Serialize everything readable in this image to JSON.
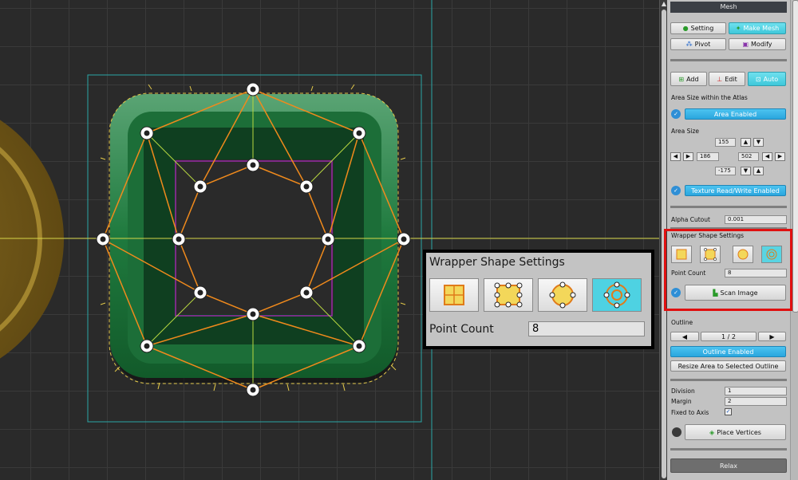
{
  "panel": {
    "title": "Mesh",
    "tabs": {
      "setting": "Setting",
      "make_mesh": "Make Mesh",
      "pivot": "Pivot",
      "modify": "Modify"
    },
    "modes": {
      "add": "Add",
      "edit": "Edit",
      "auto": "Auto"
    },
    "area_size_atlas_label": "Area Size within the Atlas",
    "area_enabled": "Area Enabled",
    "area_size_label": "Area Size",
    "area_values": {
      "top": "155",
      "left": "186",
      "right": "502",
      "bottom": "-175"
    },
    "texture_rw": "Texture Read/Write Enabled",
    "alpha_cutout_label": "Alpha Cutout",
    "alpha_cutout_value": "0.001",
    "wrapper_label": "Wrapper Shape Settings",
    "point_count_label": "Point Count",
    "point_count_value": "8",
    "scan_image": "Scan Image",
    "outline_label": "Outline",
    "outline_page": "1 / 2",
    "outline_enabled": "Outline Enabled",
    "resize_area": "Resize Area to Selected Outline",
    "division_label": "Division",
    "division_value": "1",
    "margin_label": "Margin",
    "margin_value": "2",
    "fixed_axis_label": "Fixed to Axis",
    "place_vertices": "Place Vertices",
    "relax": "Relax"
  },
  "zoom": {
    "title": "Wrapper Shape Settings",
    "point_count_label": "Point Count",
    "point_count_value": "8"
  },
  "colors": {
    "accent": "#3ec8da",
    "highlight_box": "#e01010",
    "mesh_edge": "#f08a1c",
    "mesh_green": "#1f7a3e"
  }
}
